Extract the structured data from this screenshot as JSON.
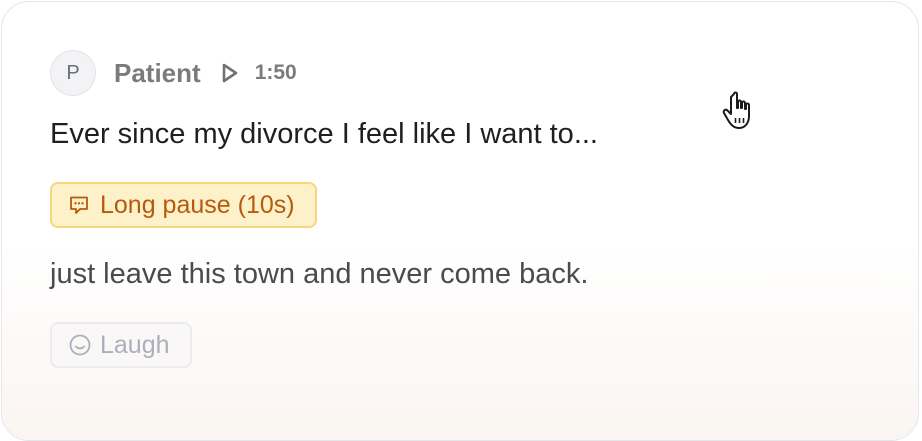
{
  "message": {
    "avatar_initial": "P",
    "speaker": "Patient",
    "timestamp": "1:50",
    "line1": "Ever since my divorce I feel like I want to...",
    "line2": "just leave this town and never come back."
  },
  "tags": {
    "pause_label": "Long pause (10s)",
    "laugh_label": "Laugh"
  },
  "icons": {
    "play": "play-icon",
    "pause_tag": "chat-bubble-icon",
    "laugh_tag": "smile-icon",
    "cursor": "hand-pointer-cursor"
  },
  "colors": {
    "pause_tag_bg": "#fdf1c9",
    "pause_tag_border": "#f6d77c",
    "pause_tag_text": "#b75a0e",
    "laugh_tag_text": "#adadbf"
  }
}
